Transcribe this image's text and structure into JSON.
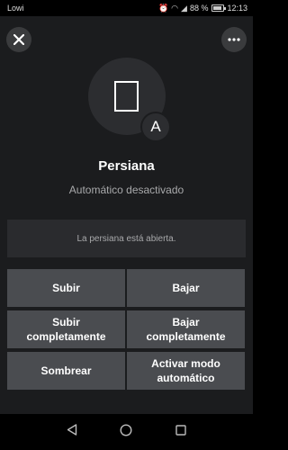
{
  "status_bar": {
    "carrier": "Lowi",
    "battery": "88 %",
    "time": "12:13"
  },
  "header": {
    "close_icon": "close-icon",
    "more_icon": "more-icon"
  },
  "device": {
    "icon": "window-blind-icon",
    "badge": "A",
    "name": "Persiana",
    "mode": "Automático desactivado"
  },
  "status_message": "La persiana está abierta.",
  "actions": [
    {
      "label": "Subir"
    },
    {
      "label": "Bajar"
    },
    {
      "label": "Subir completamente"
    },
    {
      "label": "Bajar completamente"
    },
    {
      "label": "Sombrear"
    },
    {
      "label": "Activar modo automático"
    }
  ],
  "navbar": {
    "back_icon": "back-icon",
    "home_icon": "home-icon",
    "recents_icon": "recents-icon"
  },
  "colors": {
    "background": "#1b1c1e",
    "button": "#4a4c50",
    "status_box": "#2a2b2e"
  }
}
